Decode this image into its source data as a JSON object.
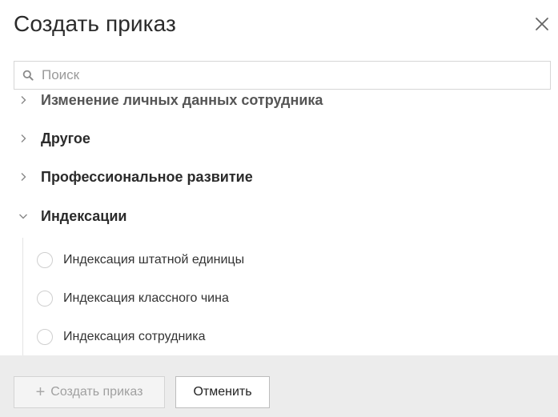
{
  "dialog": {
    "title": "Создать приказ",
    "close_icon": "close-icon"
  },
  "search": {
    "placeholder": "Поиск",
    "value": "",
    "icon": "search-icon"
  },
  "tree": {
    "groups": [
      {
        "label": "Изменение личных данных сотрудника",
        "expanded": false
      },
      {
        "label": "Другое",
        "expanded": false
      },
      {
        "label": "Профессиональное развитие",
        "expanded": false
      },
      {
        "label": "Индексации",
        "expanded": true
      }
    ],
    "options": [
      {
        "label": "Индексация штатной единицы",
        "selected": false
      },
      {
        "label": "Индексация классного чина",
        "selected": false
      },
      {
        "label": "Индексация сотрудника",
        "selected": false
      }
    ]
  },
  "footer": {
    "create_label": "Создать приказ",
    "create_disabled": true,
    "cancel_label": "Отменить"
  },
  "colors": {
    "footer_bg": "#ececec",
    "text": "#2b2b2b",
    "border": "#d6d6d6"
  }
}
